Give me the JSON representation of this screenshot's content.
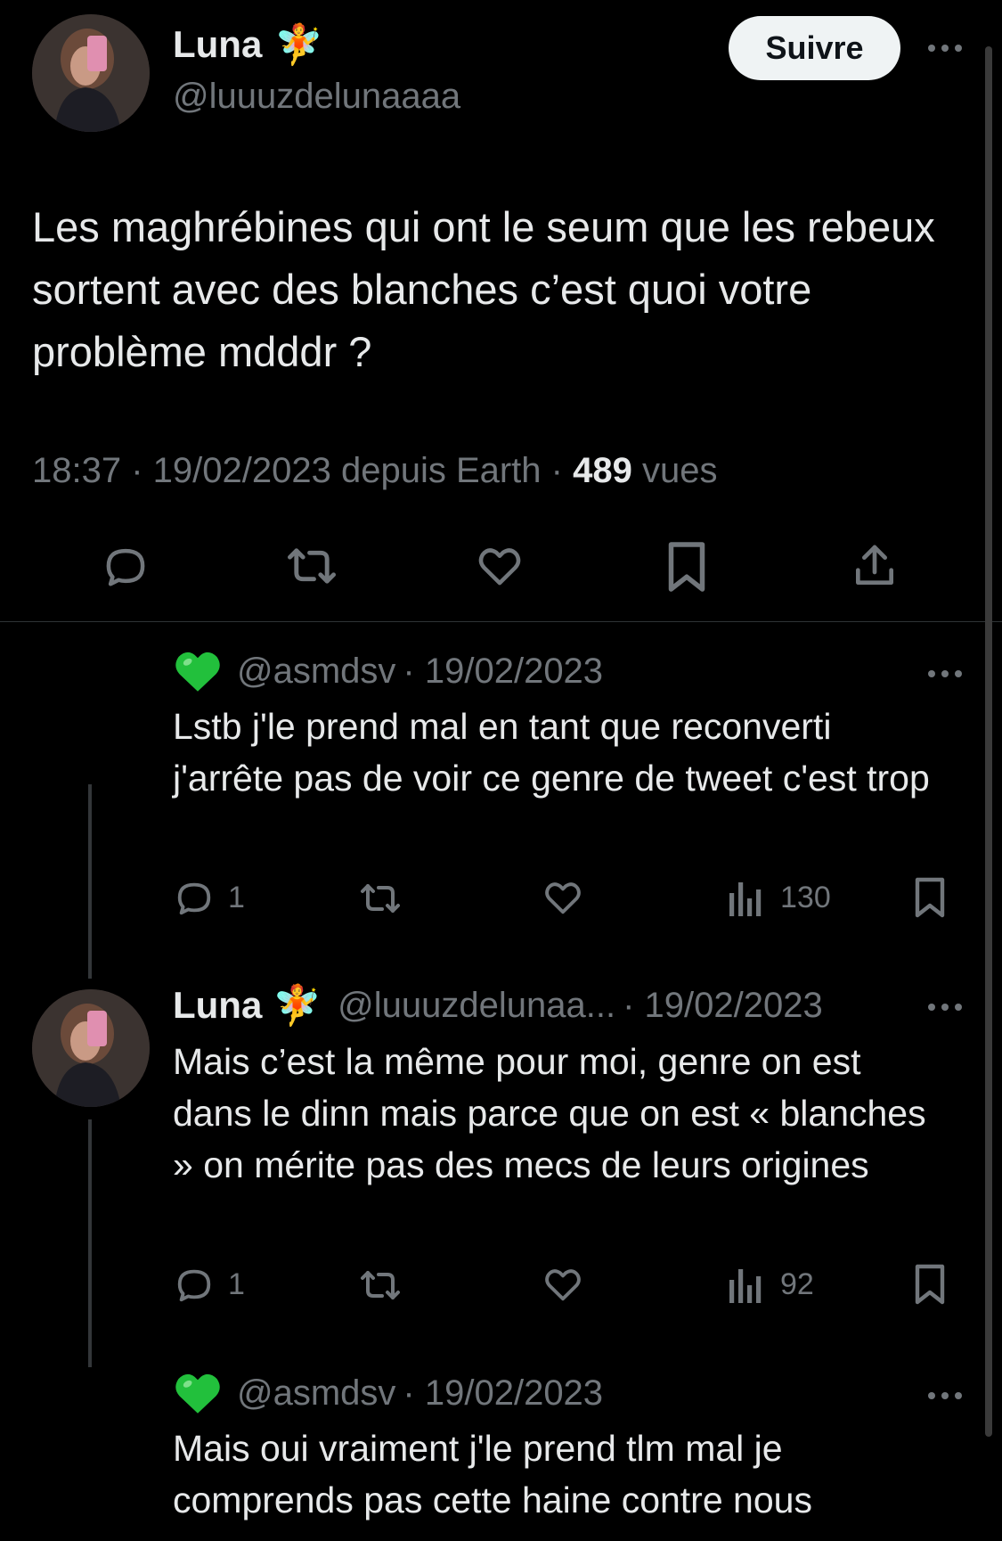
{
  "tweet": {
    "author_name": "Luna",
    "author_emoji": "🧚",
    "author_handle": "@luuuzdelunaaaa",
    "follow_label": "Suivre",
    "text": "Les maghrébines qui ont le seum que les rebeux sortent avec des blanches c’est quoi votre problème mdddr ?",
    "meta_prefix": "18:37 · 19/02/2023 depuis Earth · ",
    "views_count": "489",
    "views_label": " vues"
  },
  "replies": [
    {
      "handle": "@asmdsv",
      "date": "· 19/02/2023",
      "text": "Lstb j'le prend mal en tant que reconverti j'arrête pas de voir ce genre de tweet c'est trop",
      "reply_count": "1",
      "views": "130"
    },
    {
      "name": "Luna",
      "handle": "@luuuzdelunaa...",
      "date": "· 19/02/2023",
      "text": "Mais c’est la même pour moi, genre on est dans le dinn mais parce que on est « blanches » on mérite pas des mecs de leurs origines",
      "reply_count": "1",
      "views": "92"
    },
    {
      "handle": "@asmdsv",
      "date": "· 19/02/2023",
      "text": "Mais oui vraiment j'le prend tlm mal je comprends pas cette haine contre nous"
    }
  ],
  "icons": {
    "reply": "reply-icon",
    "retweet": "retweet-icon",
    "like": "heart-icon",
    "bookmark": "bookmark-icon",
    "share": "share-icon",
    "views": "views-icon",
    "more": "more-icon",
    "green_heart": "green-heart-emoji"
  },
  "colors": {
    "background": "#000000",
    "text": "#e7e9ea",
    "muted": "#71767b",
    "divider": "#2f3336",
    "follow_bg": "#eff3f4",
    "green_heart": "#22c03c"
  }
}
